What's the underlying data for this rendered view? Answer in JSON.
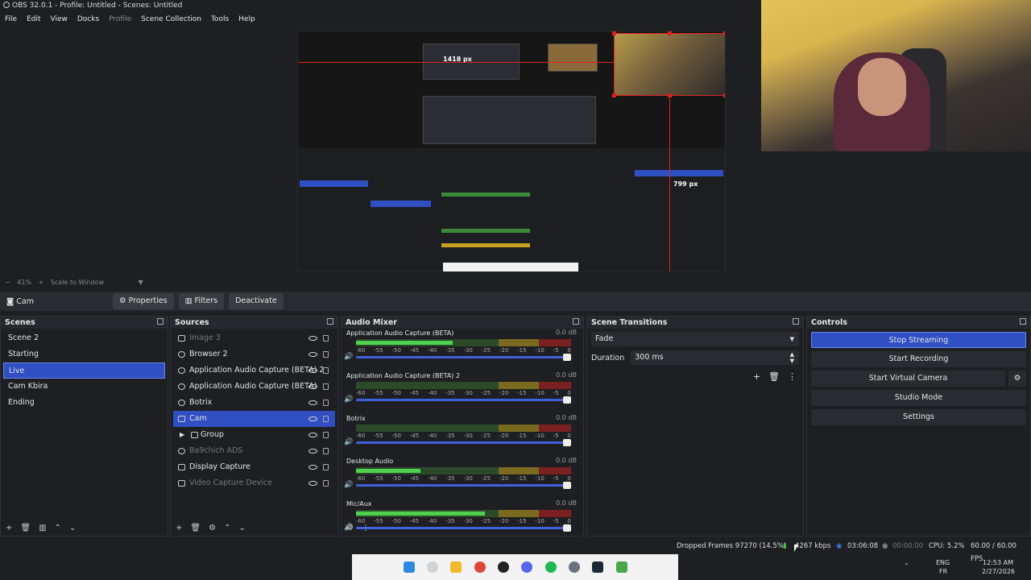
{
  "window": {
    "title": "OBS 32.0.1 - Profile: Untitled - Scenes: Untitled"
  },
  "menu": [
    "File",
    "Edit",
    "View",
    "Docks",
    "Profile",
    "Scene Collection",
    "Tools",
    "Help"
  ],
  "preview": {
    "measure_h": "1418 px",
    "measure_v": "799 px"
  },
  "zoom": {
    "level": "41%",
    "mode": "Scale to Window"
  },
  "source_bar": {
    "current": "Cam",
    "properties": "Properties",
    "filters": "Filters",
    "deactivate": "Deactivate"
  },
  "scenes": {
    "title": "Scenes",
    "items": [
      "Scene 2",
      "Starting",
      "Live",
      "Cam Kbira",
      "Ending"
    ],
    "selected": "Live"
  },
  "sources": {
    "title": "Sources",
    "items": [
      {
        "label": "Image 3",
        "hidden": true
      },
      {
        "label": "Browser 2",
        "hidden": false
      },
      {
        "label": "Application Audio Capture (BETA) 2",
        "hidden": false
      },
      {
        "label": "Application Audio Capture (BETA)",
        "hidden": false
      },
      {
        "label": "Botrix",
        "hidden": false
      },
      {
        "label": "Cam",
        "hidden": false,
        "selected": true
      },
      {
        "label": "Group",
        "hidden": false
      },
      {
        "label": "Ba9chich ADS",
        "hidden": true
      },
      {
        "label": "Display Capture",
        "hidden": false
      },
      {
        "label": "Video Capture Device",
        "hidden": true
      }
    ]
  },
  "mixer": {
    "title": "Audio Mixer",
    "channels": [
      {
        "name": "Application Audio Capture (BETA)",
        "db": "0.0 dB",
        "level": 0.45
      },
      {
        "name": "Application Audio Capture (BETA) 2",
        "db": "0.0 dB",
        "level": 0.0
      },
      {
        "name": "Botrix",
        "db": "0.0 dB",
        "level": 0.0
      },
      {
        "name": "Desktop Audio",
        "db": "0.0 dB",
        "level": 0.3
      },
      {
        "name": "Mic/Aux",
        "db": "0.0 dB",
        "level": 0.6
      }
    ],
    "scale": [
      "-60",
      "-55",
      "-50",
      "-45",
      "-40",
      "-35",
      "-30",
      "-25",
      "-20",
      "-15",
      "-10",
      "-5",
      "0"
    ]
  },
  "transitions": {
    "title": "Scene Transitions",
    "selected": "Fade",
    "duration_label": "Duration",
    "duration": "300 ms"
  },
  "controls": {
    "title": "Controls",
    "buttons": [
      "Stop Streaming",
      "Start Recording",
      "Start Virtual Camera",
      "Studio Mode",
      "Settings"
    ]
  },
  "status": {
    "dropped": "Dropped Frames 97270 (14.5%)",
    "bitrate": "4267 kbps",
    "stream_time": "03:06:08",
    "rec_time": "00:00:00",
    "cpu": "CPU: 5.2%",
    "fps": "60.00 / 60.00 FPS"
  },
  "tray": {
    "lang": "ENG",
    "region": "FR",
    "time": "12:53 AM",
    "date": "2/27/2026"
  }
}
